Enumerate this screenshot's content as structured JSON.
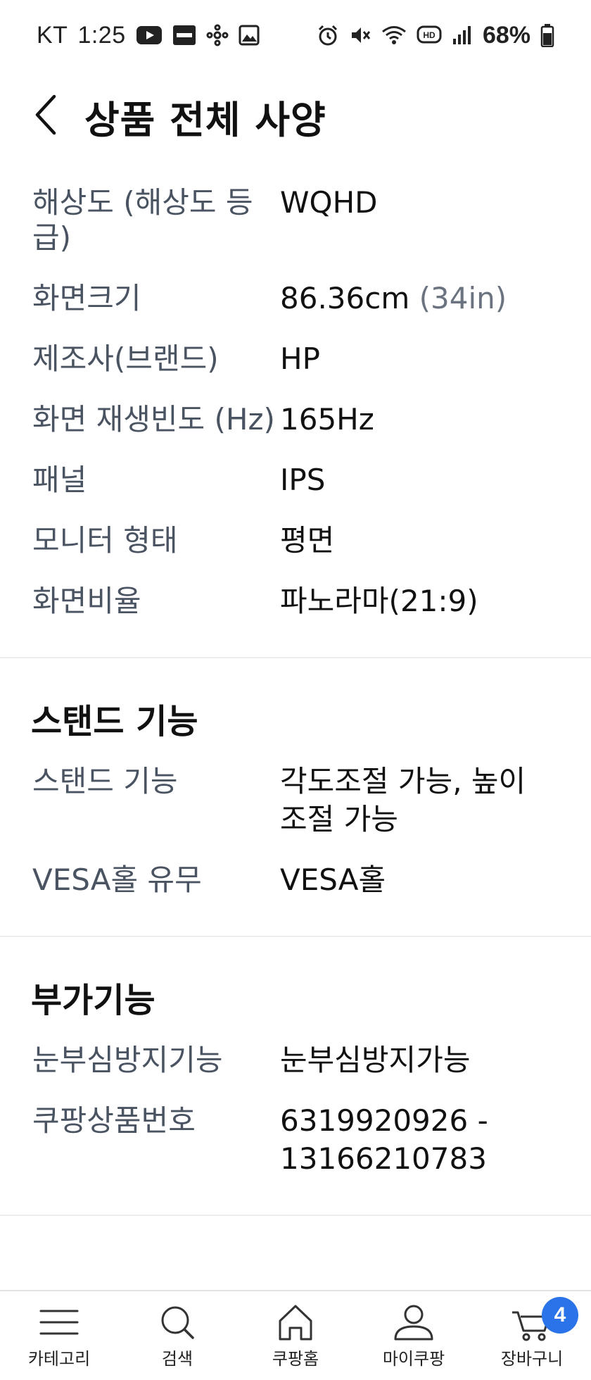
{
  "status_bar": {
    "carrier": "KT",
    "time": "1:25",
    "battery": "68%"
  },
  "header": {
    "title": "상품 전체 사양"
  },
  "sections": [
    {
      "title": "",
      "rows": [
        {
          "label": "해상도 (해상도 등급)",
          "value": "WQHD",
          "value_extra": ""
        },
        {
          "label": "화면크기",
          "value": "86.36cm",
          "value_extra": "(34in)"
        },
        {
          "label": "제조사(브랜드)",
          "value": "HP",
          "value_extra": ""
        },
        {
          "label": "화면 재생빈도 (Hz)",
          "value": "165Hz",
          "value_extra": ""
        },
        {
          "label": "패널",
          "value": "IPS",
          "value_extra": ""
        },
        {
          "label": "모니터 형태",
          "value": "평면",
          "value_extra": ""
        },
        {
          "label": "화면비율",
          "value": "파노라마(21:9)",
          "value_extra": ""
        }
      ]
    },
    {
      "title": "스탠드 기능",
      "rows": [
        {
          "label": "스탠드 기능",
          "value": "각도조절 가능, 높이 조절 가능",
          "value_extra": ""
        },
        {
          "label": "VESA홀 유무",
          "value": "VESA홀",
          "value_extra": ""
        }
      ]
    },
    {
      "title": "부가기능",
      "rows": [
        {
          "label": "눈부심방지기능",
          "value": "눈부심방지가능",
          "value_extra": ""
        },
        {
          "label": "쿠팡상품번호",
          "value": "6319920926 - 13166210783",
          "value_extra": ""
        }
      ]
    }
  ],
  "bottom_nav": {
    "items": [
      {
        "label": "카테고리",
        "icon": "menu-icon"
      },
      {
        "label": "검색",
        "icon": "search-icon"
      },
      {
        "label": "쿠팡홈",
        "icon": "home-icon"
      },
      {
        "label": "마이쿠팡",
        "icon": "user-icon"
      },
      {
        "label": "장바구니",
        "icon": "cart-icon"
      }
    ],
    "cart_count": "4"
  },
  "colors": {
    "label": "#4a5361",
    "badge": "#2a73e8"
  }
}
